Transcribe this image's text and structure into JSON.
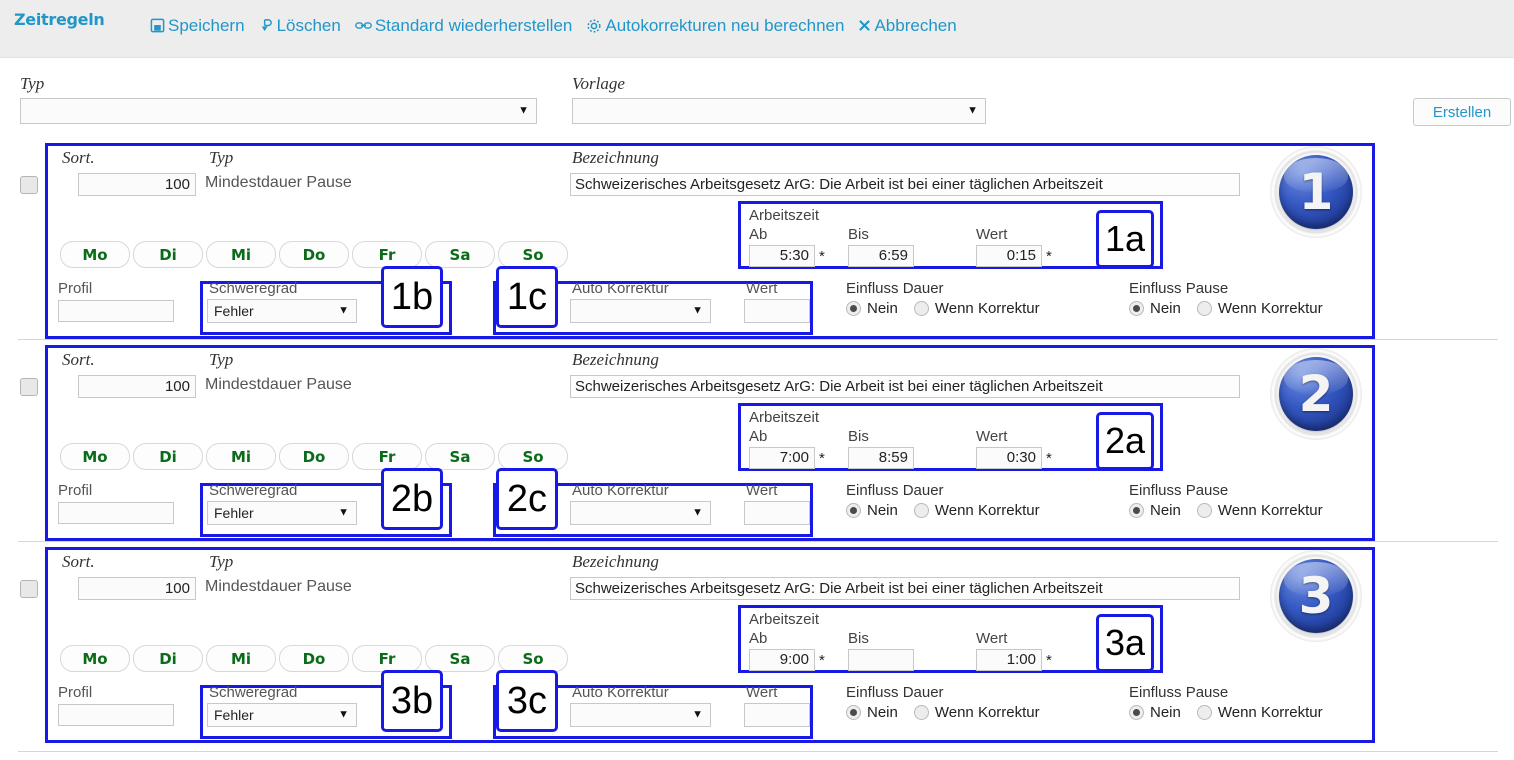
{
  "header": {
    "app_title": "Zeitregeln",
    "toolbar": [
      {
        "label": "Speichern",
        "icon": "save-icon"
      },
      {
        "label": "Löschen",
        "icon": "delete-icon"
      },
      {
        "label": "Standard wiederherstellen",
        "icon": "link-restore-icon"
      },
      {
        "label": "Autokorrekturen neu berechnen",
        "icon": "gear-icon"
      },
      {
        "label": "Abbrechen",
        "icon": "close-x-icon"
      }
    ],
    "accent_color": "#2196c9",
    "background_color": "#ededed"
  },
  "filters": {
    "typ_label": "Typ",
    "typ_value": "",
    "vorlage_label": "Vorlage",
    "vorlage_value": "",
    "create_button": "Erstellen"
  },
  "columns": {
    "sort": "Sort.",
    "typ": "Typ",
    "bezeichnung": "Bezeichnung"
  },
  "labels": {
    "arbeitszeit": "Arbeitszeit",
    "ab": "Ab",
    "bis": "Bis",
    "wert": "Wert",
    "profil": "Profil",
    "schweregrad": "Schweregrad",
    "auto_korrektur": "Auto Korrektur",
    "einfluss_dauer": "Einfluss Dauer",
    "einfluss_pause": "Einfluss Pause",
    "radio_nein": "Nein",
    "radio_wenn_korrektur": "Wenn Korrektur",
    "star": "*"
  },
  "weekdays": [
    "Mo",
    "Di",
    "Mi",
    "Do",
    "Fr",
    "Sa",
    "So"
  ],
  "annotation_color": "#1919e6",
  "rules": [
    {
      "badge": "1",
      "sort": "100",
      "typ": "Mindestdauer Pause",
      "bezeichnung": "Schweizerisches Arbeitsgesetz ArG: Die Arbeit ist bei einer täglichen Arbeitszeit",
      "ab": "5:30",
      "bis": "6:59",
      "wert": "0:15",
      "profil": "",
      "schweregrad": "Fehler",
      "auto_korrektur": "",
      "korrektur_wert": "",
      "einfluss_dauer": "Nein",
      "einfluss_pause": "Nein",
      "anno_a": "1a",
      "anno_b": "1b",
      "anno_c": "1c"
    },
    {
      "badge": "2",
      "sort": "100",
      "typ": "Mindestdauer Pause",
      "bezeichnung": "Schweizerisches Arbeitsgesetz ArG: Die Arbeit ist bei einer täglichen Arbeitszeit",
      "ab": "7:00",
      "bis": "8:59",
      "wert": "0:30",
      "profil": "",
      "schweregrad": "Fehler",
      "auto_korrektur": "",
      "korrektur_wert": "",
      "einfluss_dauer": "Nein",
      "einfluss_pause": "Nein",
      "anno_a": "2a",
      "anno_b": "2b",
      "anno_c": "2c"
    },
    {
      "badge": "3",
      "sort": "100",
      "typ": "Mindestdauer Pause",
      "bezeichnung": "Schweizerisches Arbeitsgesetz ArG: Die Arbeit ist bei einer täglichen Arbeitszeit",
      "ab": "9:00",
      "bis": "",
      "wert": "1:00",
      "profil": "",
      "schweregrad": "Fehler",
      "auto_korrektur": "",
      "korrektur_wert": "",
      "einfluss_dauer": "Nein",
      "einfluss_pause": "Nein",
      "anno_a": "3a",
      "anno_b": "3b",
      "anno_c": "3c"
    }
  ]
}
